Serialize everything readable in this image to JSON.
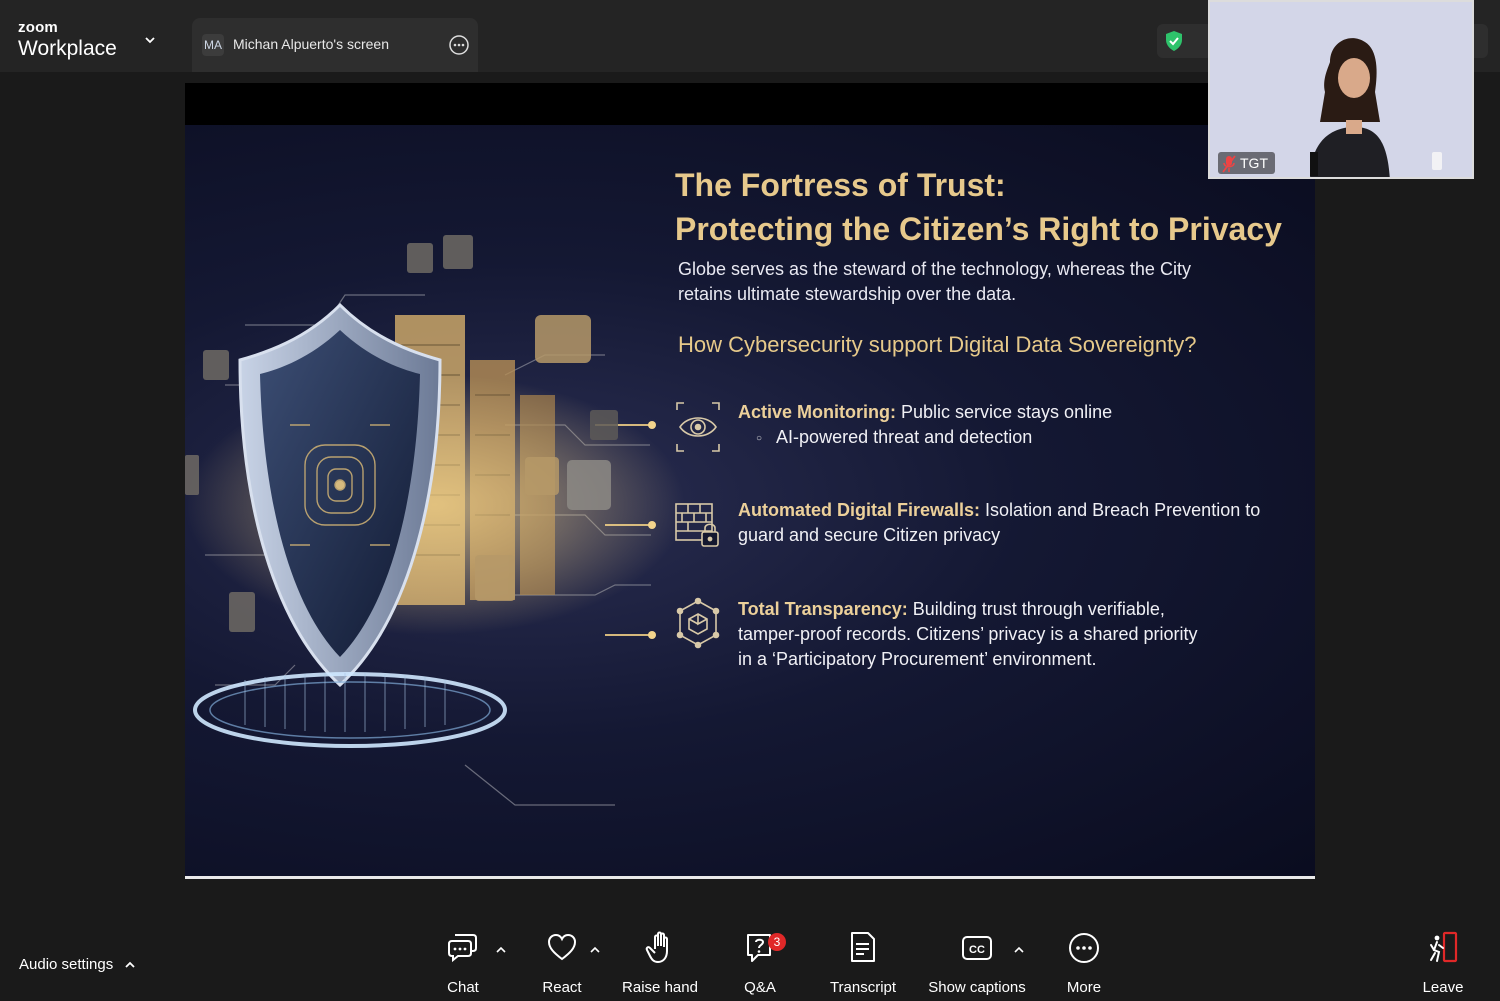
{
  "app": {
    "brand_top": "zoom",
    "brand_name": "Workplace"
  },
  "share_tab": {
    "avatar_initials": "MA",
    "title": "Michan Alpuerto's screen"
  },
  "slide": {
    "title_line1": "The Fortress of Trust:",
    "title_line2": "Protecting the Citizen’s Right to Privacy",
    "subtitle": "Globe serves as the steward of the technology, whereas the City retains ultimate stewardship over the data.",
    "question": "How Cybersecurity support Digital Data Sovereignty?",
    "bullets": [
      {
        "heading": "Active Monitoring:",
        "text": " Public service stays online",
        "sub": "AI-powered threat and detection",
        "icon": "eye-icon"
      },
      {
        "heading": "Automated Digital Firewalls:",
        "text": " Isolation and Breach Prevention to guard and secure Citizen privacy",
        "icon": "firewall-lock-icon"
      },
      {
        "heading": "Total Transparency:",
        "text": " Building trust through verifiable, tamper-proof records. Citizens’ privacy is a shared priority in a ‘Participatory Procurement’ environment.",
        "icon": "blockchain-cube-icon"
      }
    ]
  },
  "self_video": {
    "name": "TGT",
    "mic_state": "muted"
  },
  "toolbar": {
    "audio_settings": "Audio settings",
    "chat": "Chat",
    "react": "React",
    "raise_hand": "Raise hand",
    "qa": "Q&A",
    "qa_badge": "3",
    "transcript": "Transcript",
    "show_captions": "Show captions",
    "more": "More",
    "leave": "Leave"
  },
  "colors": {
    "accent_gold": "#e7c98c",
    "leave_red": "#e02828",
    "secure_green": "#2ec36b"
  }
}
